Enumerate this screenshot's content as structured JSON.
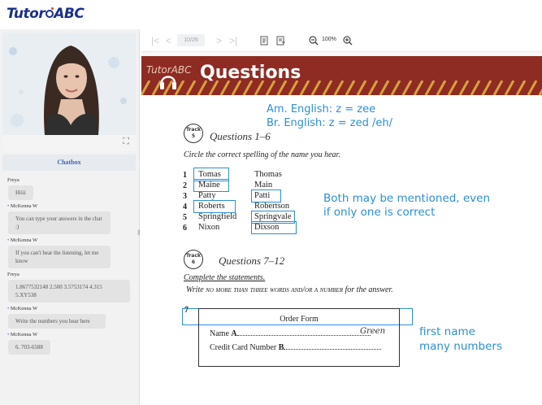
{
  "app": {
    "brand": "TutorABC"
  },
  "video": {
    "expand_glyph": "⛶"
  },
  "chat": {
    "title": "Chatbox",
    "messages": [
      {
        "name": "Freya",
        "host": false,
        "text": "Hiiii"
      },
      {
        "name": "McKenna W",
        "host": true,
        "text": "You can type your answers in the chat :)"
      },
      {
        "name": "McKenna W",
        "host": true,
        "text": "If you can't hear the listening, let me know"
      },
      {
        "name": "Freya",
        "host": false,
        "text": "1.8677532148 2.500 3.5753174 4.315 5.XY538"
      },
      {
        "name": "McKenna W",
        "host": true,
        "text": "Write the numbers you hear here"
      },
      {
        "name": "McKenna W",
        "host": true,
        "text": "6. 703-6588"
      }
    ]
  },
  "toolbar": {
    "first": "|<",
    "prev": "<",
    "page": "10/26",
    "next": ">",
    "last": ">|",
    "zoom_level": "100%"
  },
  "slide": {
    "logo": "TutorABC",
    "title": "Questions",
    "notes": {
      "am": "Am. English: z = zee",
      "br": "Br. English: z = zed /eh/",
      "both": "Both may be mentioned, even",
      "both2": "if only one is correct",
      "first_name": "first name",
      "many_numbers": "many numbers"
    },
    "track1": {
      "label": "Track",
      "num": "5",
      "heading": "Questions 1–6"
    },
    "instruction1": "Circle the correct spelling of the name you hear.",
    "rows": [
      {
        "n": "1",
        "a": "Tomas",
        "b": "Thomas"
      },
      {
        "n": "2",
        "a": "Maine",
        "b": "Main"
      },
      {
        "n": "3",
        "a": "Patty",
        "b": "Patti"
      },
      {
        "n": "4",
        "a": "Roberts",
        "b": "Robertson"
      },
      {
        "n": "5",
        "a": "Springfield",
        "b": "Springvale"
      },
      {
        "n": "6",
        "a": "Nixon",
        "b": "Dixson"
      }
    ],
    "track2": {
      "label": "Track",
      "num": "6",
      "heading": "Questions 7–12"
    },
    "instruction2": "Complete the statements.",
    "instruction3_a": "Write ",
    "instruction3_b": "no more than three words and/or a number",
    "instruction3_c": " for the answer.",
    "q7": "7",
    "form": {
      "title": "Order Form",
      "name_label": "Name ",
      "name_letter": "A",
      "name_answer": "Green",
      "card_label": "Credit Card Number ",
      "card_letter": "B"
    }
  },
  "colors": {
    "accent_blue": "#2b8fd6",
    "header_red": "#8e2b22",
    "brand_blue": "#1b2f8a"
  }
}
